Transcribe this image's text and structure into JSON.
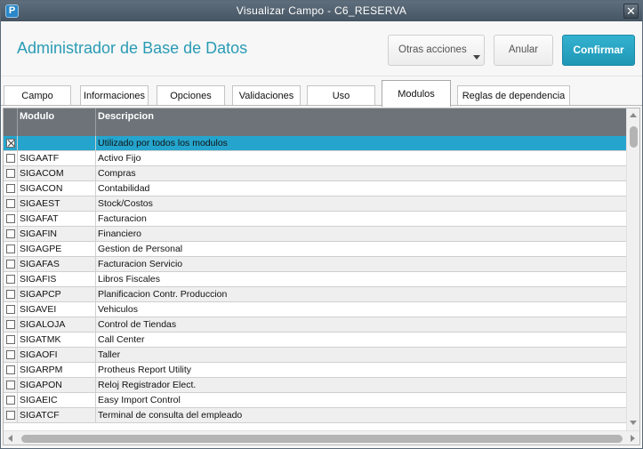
{
  "window": {
    "title": "Visualizar Campo - C6_RESERVA",
    "close_glyph": "✕",
    "app_icon_glyph": "P"
  },
  "header": {
    "title": "Administrador de Base de Datos",
    "other_actions_label": "Otras acciones",
    "cancel_label": "Anular",
    "confirm_label": "Confirmar"
  },
  "tabs": [
    {
      "label": "Campo",
      "active": false
    },
    {
      "label": "Informaciones",
      "active": false
    },
    {
      "label": "Opciones",
      "active": false
    },
    {
      "label": "Validaciones",
      "active": false
    },
    {
      "label": "Uso",
      "active": false
    },
    {
      "label": "Modulos",
      "active": true
    },
    {
      "label": "Reglas de dependencia",
      "active": false
    }
  ],
  "grid": {
    "columns": [
      "",
      "Modulo",
      "Descripcion"
    ],
    "rows": [
      {
        "checked": true,
        "modulo": "",
        "descripcion": "Utilizado por todos los modulos",
        "selected": true
      },
      {
        "checked": false,
        "modulo": "SIGAATF",
        "descripcion": "Activo Fijo"
      },
      {
        "checked": false,
        "modulo": "SIGACOM",
        "descripcion": "Compras"
      },
      {
        "checked": false,
        "modulo": "SIGACON",
        "descripcion": "Contabilidad"
      },
      {
        "checked": false,
        "modulo": "SIGAEST",
        "descripcion": "Stock/Costos"
      },
      {
        "checked": false,
        "modulo": "SIGAFAT",
        "descripcion": "Facturacion"
      },
      {
        "checked": false,
        "modulo": "SIGAFIN",
        "descripcion": "Financiero"
      },
      {
        "checked": false,
        "modulo": "SIGAGPE",
        "descripcion": "Gestion de Personal"
      },
      {
        "checked": false,
        "modulo": "SIGAFAS",
        "descripcion": "Facturacion Servicio"
      },
      {
        "checked": false,
        "modulo": "SIGAFIS",
        "descripcion": "Libros Fiscales"
      },
      {
        "checked": false,
        "modulo": "SIGAPCP",
        "descripcion": "Planificacion Contr. Produccion"
      },
      {
        "checked": false,
        "modulo": "SIGAVEI",
        "descripcion": "Vehiculos"
      },
      {
        "checked": false,
        "modulo": "SIGALOJA",
        "descripcion": "Control de Tiendas"
      },
      {
        "checked": false,
        "modulo": "SIGATMK",
        "descripcion": "Call Center"
      },
      {
        "checked": false,
        "modulo": "SIGAOFI",
        "descripcion": "Taller"
      },
      {
        "checked": false,
        "modulo": "SIGARPM",
        "descripcion": "Protheus Report Utility"
      },
      {
        "checked": false,
        "modulo": "SIGAPON",
        "descripcion": "Reloj Registrador Elect."
      },
      {
        "checked": false,
        "modulo": "SIGAEIC",
        "descripcion": "Easy Import Control"
      },
      {
        "checked": false,
        "modulo": "SIGATCF",
        "descripcion": "Terminal de consulta del empleado"
      }
    ]
  },
  "colors": {
    "accent": "#2a9bb4",
    "confirm": "#1f97b5",
    "selected_row": "#25a5cd",
    "grid_header": "#6d7378"
  }
}
